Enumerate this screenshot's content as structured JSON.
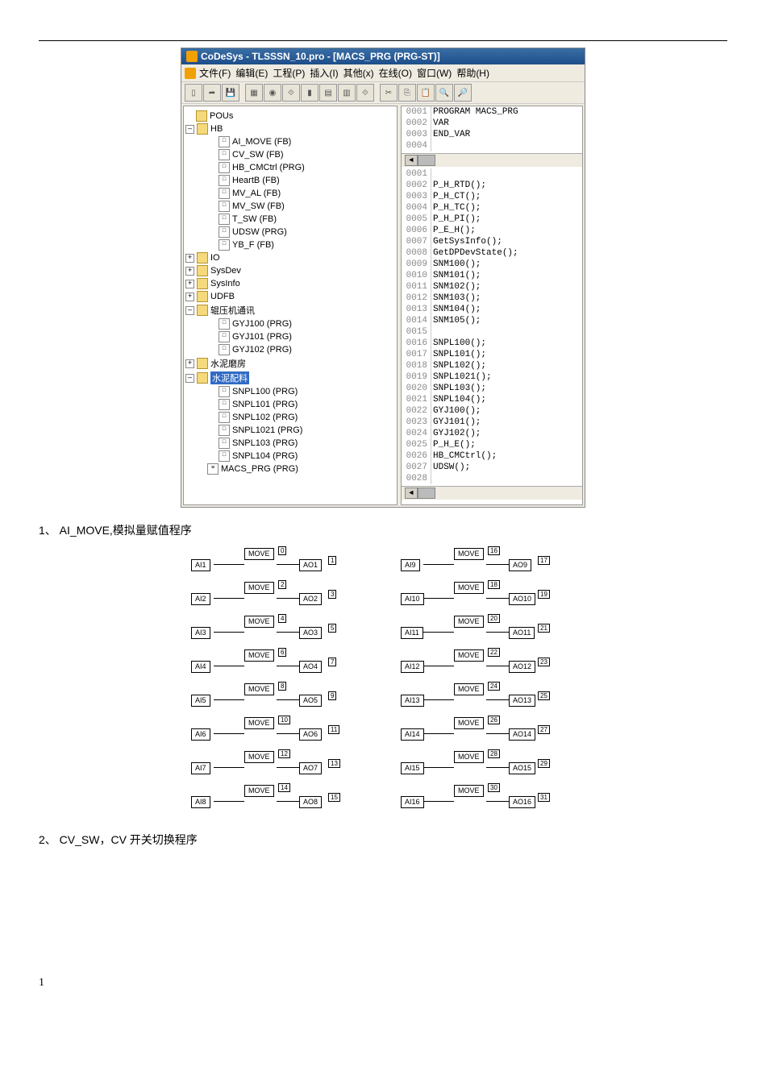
{
  "title": "CoDeSys - TLSSSN_10.pro - [MACS_PRG (PRG-ST)]",
  "menu": [
    "文件(F)",
    "编辑(E)",
    "工程(P)",
    "插入(I)",
    "其他(x)",
    "在线(O)",
    "窗口(W)",
    "帮助(H)"
  ],
  "tree": {
    "root": "POUs",
    "hb": {
      "label": "HB",
      "children": [
        "AI_MOVE (FB)",
        "CV_SW (FB)",
        "HB_CMCtrl (PRG)",
        "HeartB (FB)",
        "MV_AL (FB)",
        "MV_SW (FB)",
        "T_SW (FB)",
        "UDSW (PRG)",
        "YB_F (FB)"
      ]
    },
    "folders": [
      "IO",
      "SysDev",
      "SysInfo",
      "UDFB"
    ],
    "gtx": {
      "label": "辊压机通讯",
      "children": [
        "GYJ100 (PRG)",
        "GYJ101 (PRG)",
        "GYJ102 (PRG)"
      ]
    },
    "snmf": "水泥磨房",
    "snpl": {
      "label": "水泥配料",
      "children": [
        "SNPL100 (PRG)",
        "SNPL101 (PRG)",
        "SNPL102 (PRG)",
        "SNPL1021 (PRG)",
        "SNPL103 (PRG)",
        "SNPL104 (PRG)"
      ]
    },
    "macs": "MACS_PRG (PRG)"
  },
  "decl": [
    {
      "n": "0001",
      "t": "PROGRAM MACS_PRG"
    },
    {
      "n": "0002",
      "t": "VAR"
    },
    {
      "n": "0003",
      "t": "END_VAR"
    },
    {
      "n": "0004",
      "t": ""
    }
  ],
  "body": [
    {
      "n": "0001",
      "t": ""
    },
    {
      "n": "0002",
      "t": "P_H_RTD();"
    },
    {
      "n": "0003",
      "t": "P_H_CT();"
    },
    {
      "n": "0004",
      "t": "P_H_TC();"
    },
    {
      "n": "0005",
      "t": "P_H_PI();"
    },
    {
      "n": "0006",
      "t": "P_E_H();"
    },
    {
      "n": "0007",
      "t": "GetSysInfo();"
    },
    {
      "n": "0008",
      "t": "GetDPDevState();"
    },
    {
      "n": "0009",
      "t": "SNM100();"
    },
    {
      "n": "0010",
      "t": "SNM101();"
    },
    {
      "n": "0011",
      "t": "SNM102();"
    },
    {
      "n": "0012",
      "t": "SNM103();"
    },
    {
      "n": "0013",
      "t": "SNM104();"
    },
    {
      "n": "0014",
      "t": "SNM105();"
    },
    {
      "n": "0015",
      "t": ""
    },
    {
      "n": "0016",
      "t": "SNPL100();"
    },
    {
      "n": "0017",
      "t": "SNPL101();"
    },
    {
      "n": "0018",
      "t": "SNPL102();"
    },
    {
      "n": "0019",
      "t": "SNPL1021();"
    },
    {
      "n": "0020",
      "t": "SNPL103();"
    },
    {
      "n": "0021",
      "t": "SNPL104();"
    },
    {
      "n": "0022",
      "t": "GYJ100();"
    },
    {
      "n": "0023",
      "t": "GYJ101();"
    },
    {
      "n": "0024",
      "t": "GYJ102();"
    },
    {
      "n": "0025",
      "t": "P_H_E();"
    },
    {
      "n": "0026",
      "t": "HB_CMCtrl();"
    },
    {
      "n": "0027",
      "t": "UDSW();"
    },
    {
      "n": "0028",
      "t": ""
    }
  ],
  "cap1": "1、 AI_MOVE,模拟量赋值程序",
  "cap2": "2、 CV_SW，CV 开关切换程序",
  "move": "MOVE",
  "fbd": {
    "left": [
      {
        "in": "AI1",
        "out": "AO1",
        "a": "0",
        "b": "1"
      },
      {
        "in": "AI2",
        "out": "AO2",
        "a": "2",
        "b": "3"
      },
      {
        "in": "AI3",
        "out": "AO3",
        "a": "4",
        "b": "5"
      },
      {
        "in": "AI4",
        "out": "AO4",
        "a": "6",
        "b": "7"
      },
      {
        "in": "AI5",
        "out": "AO5",
        "a": "8",
        "b": "9"
      },
      {
        "in": "AI6",
        "out": "AO6",
        "a": "10",
        "b": "11"
      },
      {
        "in": "AI7",
        "out": "AO7",
        "a": "12",
        "b": "13"
      },
      {
        "in": "AI8",
        "out": "AO8",
        "a": "14",
        "b": "15"
      }
    ],
    "right": [
      {
        "in": "AI9",
        "out": "AO9",
        "a": "16",
        "b": "17"
      },
      {
        "in": "AI10",
        "out": "AO10",
        "a": "18",
        "b": "19"
      },
      {
        "in": "AI11",
        "out": "AO11",
        "a": "20",
        "b": "21"
      },
      {
        "in": "AI12",
        "out": "AO12",
        "a": "22",
        "b": "23"
      },
      {
        "in": "AI13",
        "out": "AO13",
        "a": "24",
        "b": "25"
      },
      {
        "in": "AI14",
        "out": "AO14",
        "a": "26",
        "b": "27"
      },
      {
        "in": "AI15",
        "out": "AO15",
        "a": "28",
        "b": "29"
      },
      {
        "in": "AI16",
        "out": "AO16",
        "a": "30",
        "b": "31"
      }
    ]
  },
  "pagenum": "1"
}
